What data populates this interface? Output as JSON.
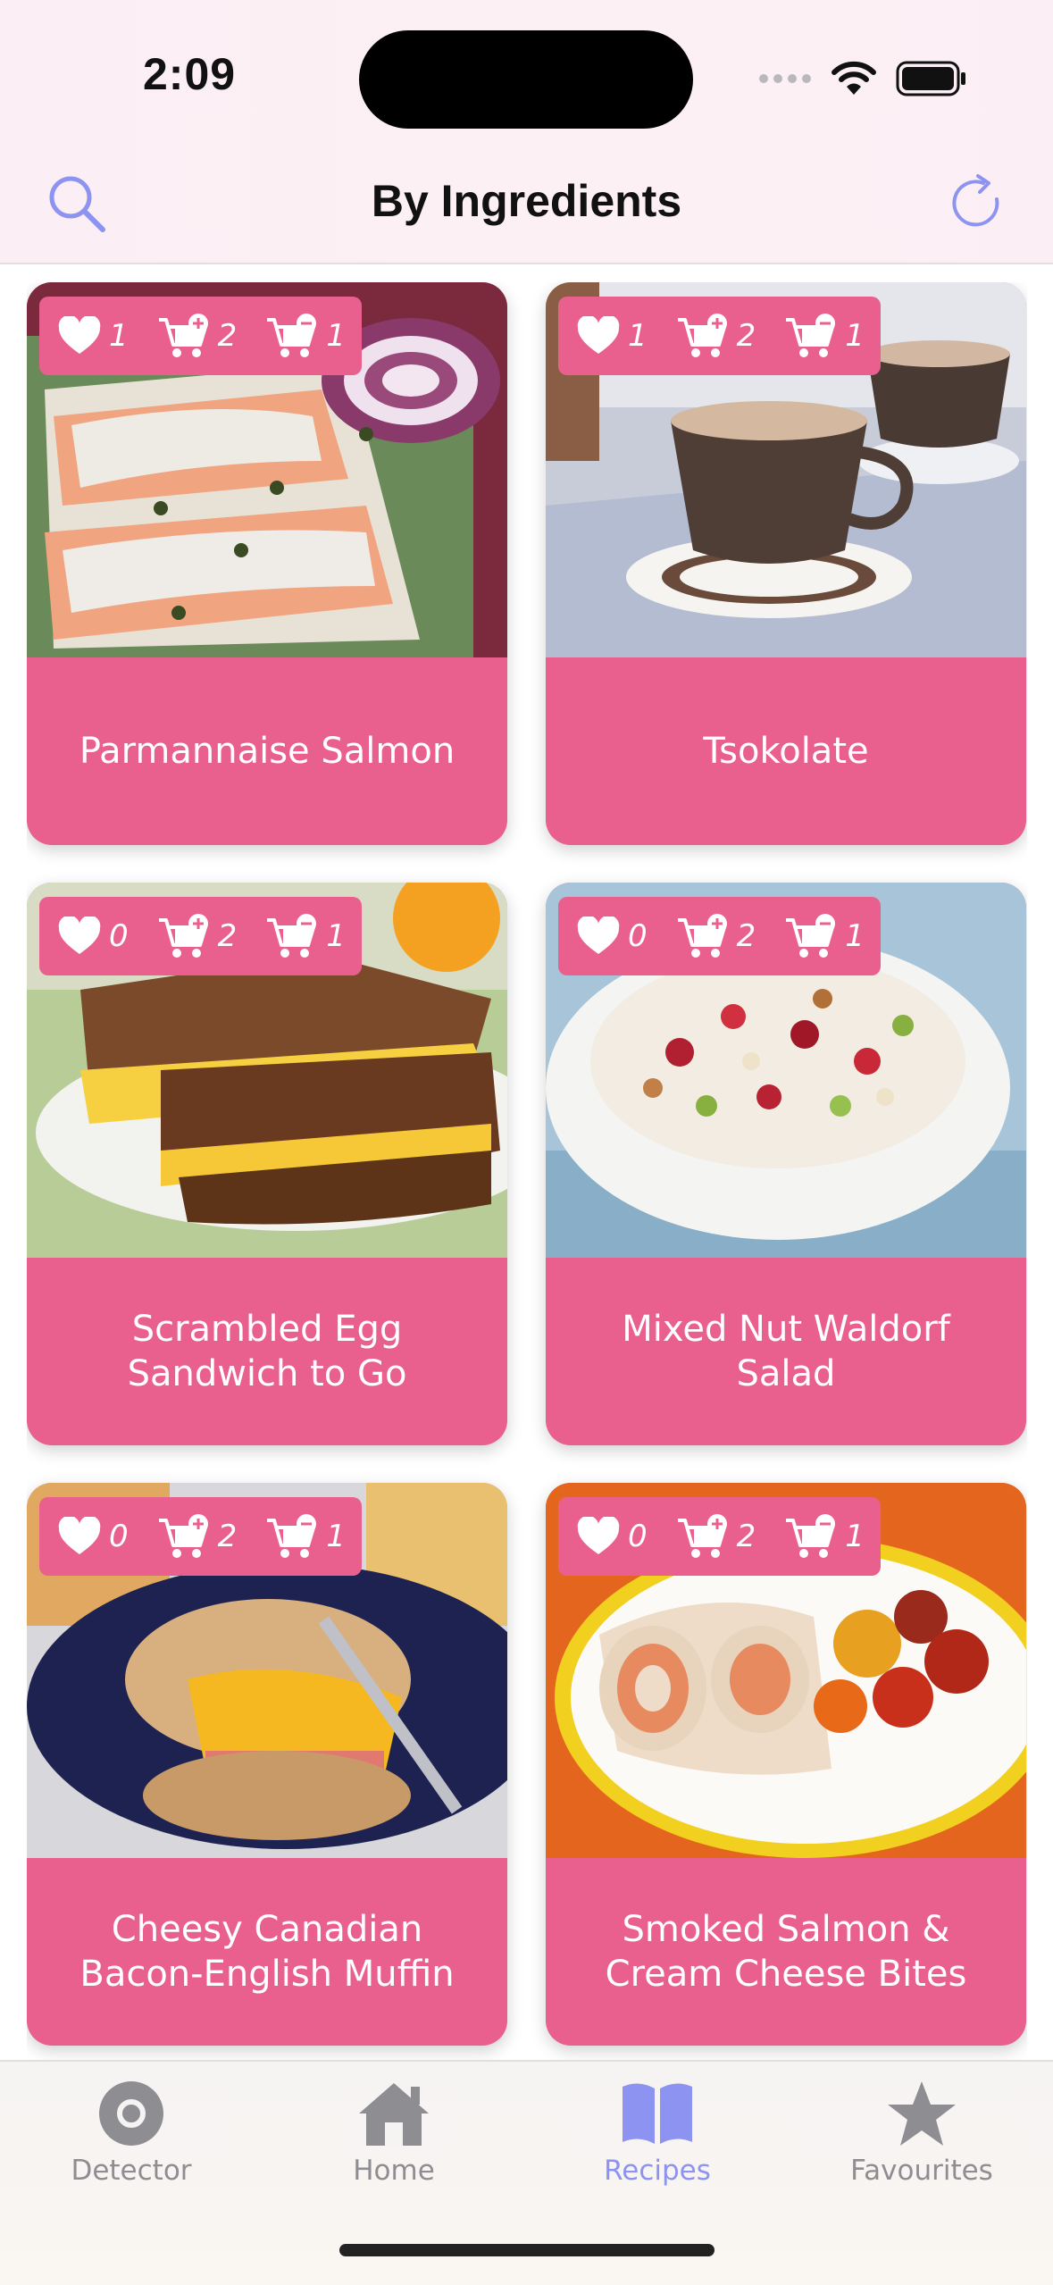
{
  "status": {
    "time": "2:09"
  },
  "nav": {
    "title": "By Ingredients"
  },
  "recipes": [
    {
      "title": "Parmannaise Salmon",
      "likes": "1",
      "cart_add": "2",
      "cart_remove": "1"
    },
    {
      "title": "Tsokolate",
      "likes": "1",
      "cart_add": "2",
      "cart_remove": "1"
    },
    {
      "title": "Scrambled Egg Sandwich to Go",
      "likes": "0",
      "cart_add": "2",
      "cart_remove": "1"
    },
    {
      "title": "Mixed Nut Waldorf Salad",
      "likes": "0",
      "cart_add": "2",
      "cart_remove": "1"
    },
    {
      "title": "Cheesy Canadian Bacon-English Muffin",
      "likes": "0",
      "cart_add": "2",
      "cart_remove": "1"
    },
    {
      "title": "Smoked Salmon & Cream Cheese Bites",
      "likes": "0",
      "cart_add": "2",
      "cart_remove": "1"
    }
  ],
  "tabs": [
    {
      "label": "Detector",
      "icon": "detector-icon"
    },
    {
      "label": "Home",
      "icon": "house-icon"
    },
    {
      "label": "Recipes",
      "icon": "book-icon",
      "active": true
    },
    {
      "label": "Favourites",
      "icon": "star-icon"
    }
  ],
  "colors": {
    "accent": "#8c93f0",
    "card": "#e9608f",
    "inactive_tab": "#8e8e92"
  }
}
